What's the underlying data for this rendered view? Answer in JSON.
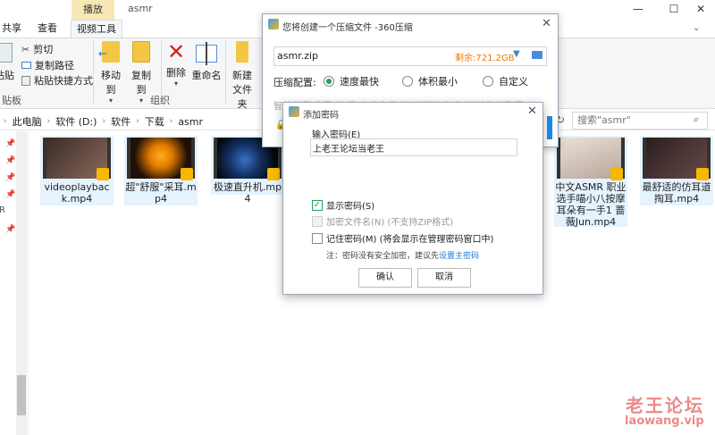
{
  "explorer": {
    "window_title": "asmr",
    "context_tab": "播放",
    "tabs": [
      "共享",
      "查看",
      "视频工具"
    ],
    "ribbon": {
      "cut": "剪切",
      "copy_path": "复制路径",
      "paste_shortcut": "粘贴快捷方式",
      "paste": "粘贴",
      "move_to": "移动到",
      "copy_to": "复制到",
      "delete": "删除",
      "rename": "重命名",
      "new_folder_1": "新建",
      "new_folder_2": "文件夹",
      "group_clipboard": "贴板",
      "group_organize": "组织"
    },
    "breadcrumbs": [
      "此电脑",
      "软件 (D:)",
      "软件",
      "下载",
      "asmr"
    ],
    "search_placeholder": "搜索\"asmr\"",
    "files": [
      {
        "name": "videoplayback.mp4"
      },
      {
        "name": "超\"舒服\"采耳.mp4"
      },
      {
        "name": "极速直升机.mp4"
      },
      {
        "name": "中文ASMR 职业选手喵小八按摩耳朵有一手1 蔷薇Jun.mp4"
      },
      {
        "name": "最舒适的仿耳道掏耳.mp4"
      }
    ]
  },
  "zip_window": {
    "title": "您将创建一个压缩文件 -360压缩",
    "filename": "asmr.zip",
    "free_space": "剩余:721.2GB",
    "option_label": "压缩配置:",
    "options": [
      "速度最快",
      "体积最小",
      "自定义"
    ],
    "blurred_text": "智能关联设置  说明  文件名称 更改压缩格式  更新压缩配置"
  },
  "password_dialog": {
    "title": "添加密码",
    "input_label": "输入密码(E)",
    "password_value": "上老王论坛当老王",
    "show_password": "显示密码(S)",
    "encrypt_names": "加密文件名(N) (不支持ZIP格式)",
    "remember_password": "记住密码(M) (将会显示在管理密码窗口中)",
    "note_prefix": "注：密码没有安全加密，建议先",
    "note_link": "设置主密码",
    "ok": "确认",
    "cancel": "取消"
  },
  "watermark": {
    "line1": "老王论坛",
    "line2": "laowang.vip"
  }
}
